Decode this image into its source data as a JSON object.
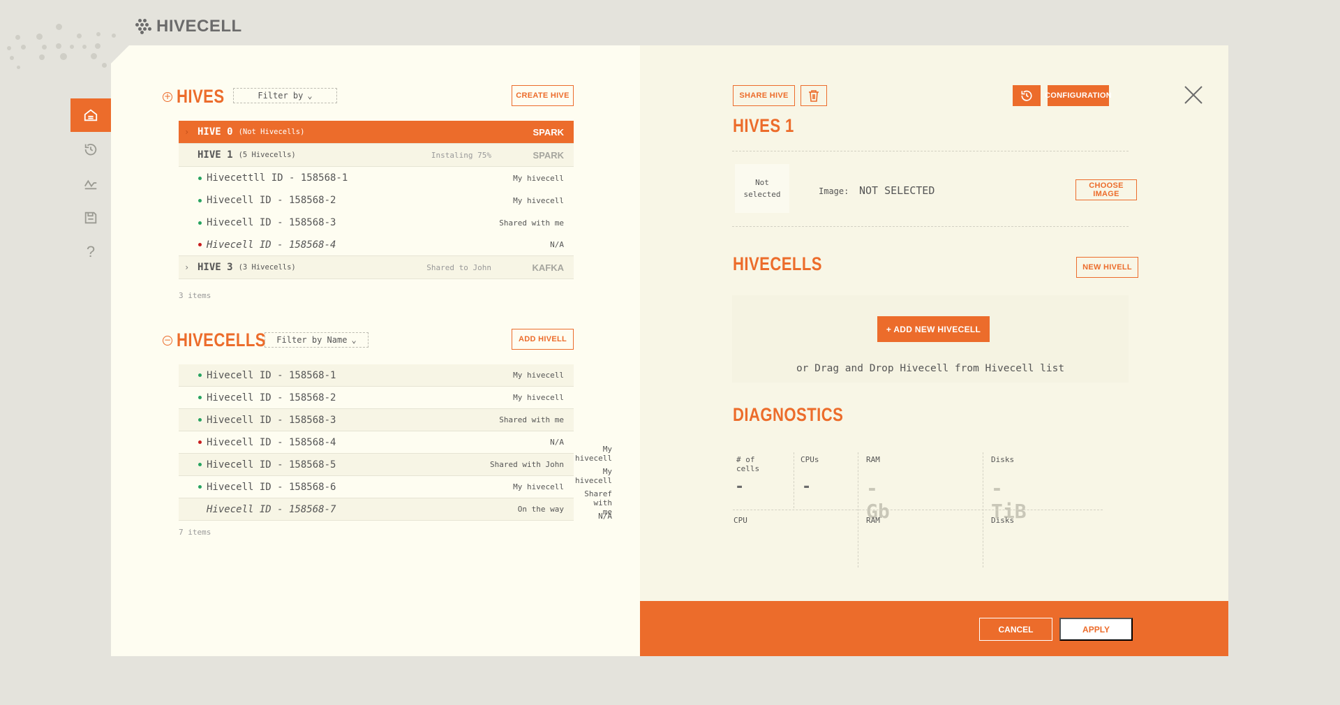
{
  "app": {
    "logo_text": "HIVECELL"
  },
  "sidebar": {
    "items": [
      {
        "icon": "home-icon",
        "active": true
      },
      {
        "icon": "history-icon",
        "active": false
      },
      {
        "icon": "activity-icon",
        "active": false
      },
      {
        "icon": "save-icon",
        "active": false
      },
      {
        "icon": "help-icon",
        "active": false,
        "glyph": "?"
      }
    ]
  },
  "hives": {
    "title": "HIVES",
    "toggle": "+",
    "filter_label": "Filter by",
    "create_button": "CREATE HIVE",
    "rows": [
      {
        "name": "HIVE 0",
        "sub": "(Not Hivecells)",
        "status": "",
        "type": "SPARK",
        "selected": true
      },
      {
        "name": "HIVE 1",
        "sub": "(5 Hivecells)",
        "status": "Instaling 75%",
        "type": "SPARK",
        "selected": false
      },
      {
        "name": "HIVE 3",
        "sub": "(3 Hivecells)",
        "status": "Shared to John",
        "type": "KAFKA",
        "selected": false
      }
    ],
    "hive1_cells": [
      {
        "name": "Hivecettll ID - 158568-1",
        "owner": "My hivecell",
        "status": "green",
        "italic": false
      },
      {
        "name": "Hivecell ID - 158568-2",
        "owner": "My hivecell",
        "status": "green",
        "italic": false
      },
      {
        "name": "Hivecell ID - 158568-3",
        "owner": "Shared with me",
        "status": "green",
        "italic": false
      },
      {
        "name": "Hivecell ID - 158568-4",
        "owner": "N/A",
        "status": "red",
        "italic": true
      }
    ],
    "count": "3 items"
  },
  "hivecells": {
    "title": "HIVECELLS",
    "toggle": "−",
    "filter_label": "Filter by Name",
    "add_button": "ADD HIVELL",
    "rows": [
      {
        "name": "Hivecell ID - 158568-1",
        "owner": "My hivecell",
        "status": "green",
        "italic": false
      },
      {
        "name": "Hivecell ID - 158568-2",
        "owner": "My hivecell",
        "status": "green",
        "italic": false
      },
      {
        "name": "Hivecell ID - 158568-3",
        "owner": "Shared with me",
        "status": "green",
        "italic": false
      },
      {
        "name": "Hivecell ID - 158568-4",
        "owner": "N/A",
        "status": "red",
        "italic": false
      },
      {
        "name": "Hivecell ID - 158568-5",
        "owner": "Shared with John",
        "status": "green",
        "italic": false
      },
      {
        "name": "Hivecell ID - 158568-6",
        "owner": "My hivecell",
        "status": "green",
        "italic": false
      },
      {
        "name": "Hivecell ID - 158568-7",
        "owner": "On the way",
        "status": "none",
        "italic": true
      }
    ],
    "count": "7 items"
  },
  "detail": {
    "share_button": "SHARE HIVE",
    "config_button": "CONFIGURATION",
    "title": "HIVES 1",
    "image_box": "Not selected",
    "image_label": "Image:",
    "image_value": "NOT SELECTED",
    "choose_image_button": "CHOOSE IMAGE",
    "hivecells_title": "HIVECELLS",
    "new_hivell_button": "NEW HIVELL",
    "add_new_button": "+ ADD NEW HIVECELL",
    "drop_text": "or Drag and Drop Hivecell from Hivecell list",
    "diagnostics_title": "DIAGNOSTICS",
    "diag": {
      "cells_label": "# of cells",
      "cells_value": "-",
      "cpus_label": "CPUs",
      "cpus_value": "-",
      "ram_label": "RAM",
      "ram_value": "-Gb",
      "disks_label": "Disks",
      "disks_value": "-TiB",
      "cpu_label2": "CPU",
      "ram_label2": "RAM",
      "disks_label2": "Disks"
    },
    "side_list": [
      "My hivecell",
      "My hivecell",
      "Sharef with me",
      "N/A"
    ]
  },
  "footer": {
    "cancel": "CANCEL",
    "apply": "APPLY"
  },
  "colors": {
    "accent": "#ec6c2b",
    "bg": "#e4e3dc",
    "panel": "#fefdf1",
    "green": "#27a360",
    "red": "#c81d1d"
  }
}
